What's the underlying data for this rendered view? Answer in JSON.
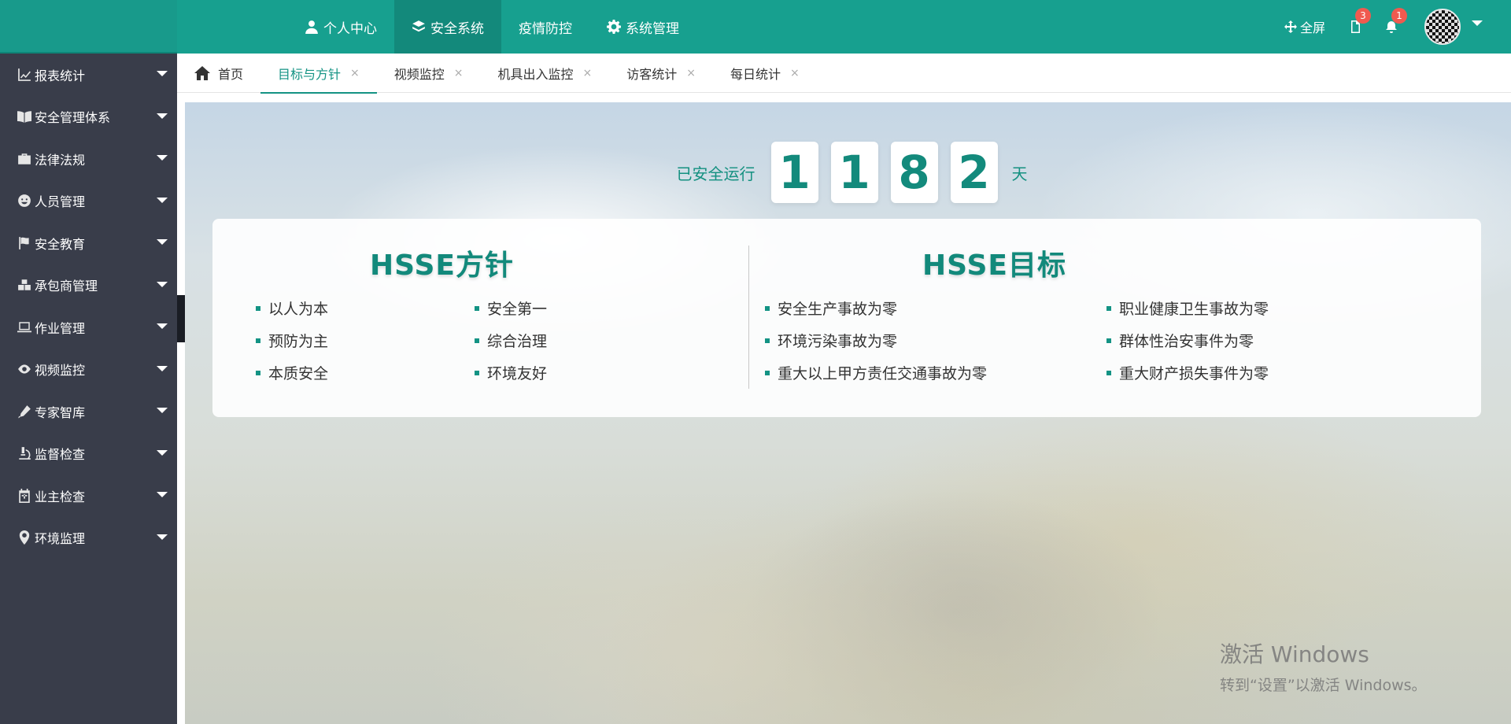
{
  "header": {
    "nav": [
      {
        "label": "个人中心",
        "icon": "user-icon"
      },
      {
        "label": "安全系统",
        "icon": "layers-icon",
        "active": true
      },
      {
        "label": "疫情防控",
        "icon": ""
      },
      {
        "label": "系统管理",
        "icon": "gear-icon"
      }
    ],
    "fullscreen_label": "全屏",
    "docs_badge": "3",
    "bell_badge": "1"
  },
  "sidebar": {
    "items": [
      {
        "label": "报表统计",
        "icon": "chart-icon"
      },
      {
        "label": "安全管理体系",
        "icon": "book-icon"
      },
      {
        "label": "法律法规",
        "icon": "briefcase-icon"
      },
      {
        "label": "人员管理",
        "icon": "smile-icon"
      },
      {
        "label": "安全教育",
        "icon": "flag-icon"
      },
      {
        "label": "承包商管理",
        "icon": "boxes-icon"
      },
      {
        "label": "作业管理",
        "icon": "laptop-icon"
      },
      {
        "label": "视频监控",
        "icon": "eye-icon"
      },
      {
        "label": "专家智库",
        "icon": "pen-icon"
      },
      {
        "label": "监督检查",
        "icon": "microscope-icon"
      },
      {
        "label": "业主检查",
        "icon": "calendar-icon"
      },
      {
        "label": "环境监理",
        "icon": "map-pin-icon"
      }
    ]
  },
  "tabs": [
    {
      "label": "首页",
      "home": true
    },
    {
      "label": "目标与方针",
      "active": true
    },
    {
      "label": "视频监控"
    },
    {
      "label": "机具出入监控"
    },
    {
      "label": "访客统计"
    },
    {
      "label": "每日统计"
    }
  ],
  "tab_close": "×",
  "safety": {
    "label": "已安全运行",
    "digits": [
      "1",
      "1",
      "8",
      "2"
    ],
    "unit": "天"
  },
  "policy": {
    "title": "HSSE方针",
    "items": [
      "以人为本",
      "安全第一",
      "预防为主",
      "综合治理",
      "本质安全",
      "环境友好"
    ]
  },
  "goals": {
    "title": "HSSE目标",
    "items": [
      "安全生产事故为零",
      "职业健康卫生事故为零",
      "环境污染事故为零",
      "群体性治安事件为零",
      "重大以上甲方责任交通事故为零",
      "重大财产损失事件为零"
    ]
  },
  "watermark": {
    "line1": "激活 Windows",
    "line2": "转到“设置”以激活 Windows。"
  },
  "colors": {
    "header": "#17a08f",
    "sidebar": "#393d4a",
    "accent": "#149384",
    "badge": "#f05a4f"
  }
}
